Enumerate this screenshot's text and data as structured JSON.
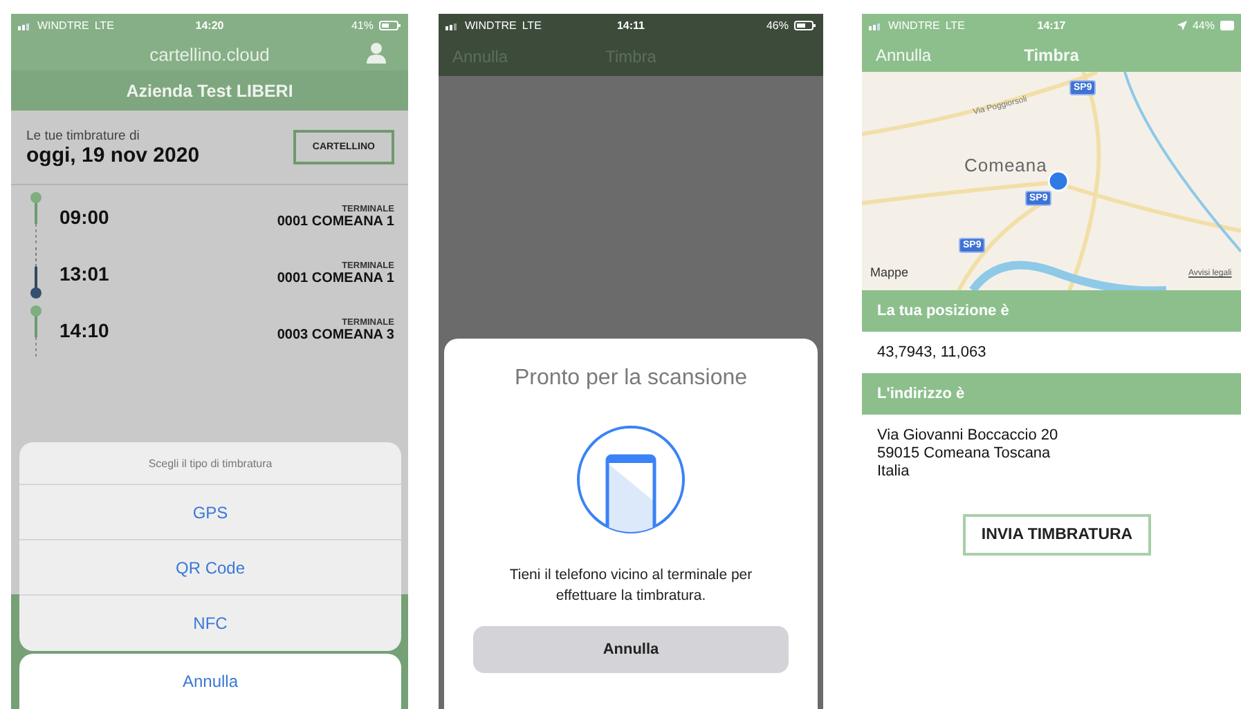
{
  "left_screen": {
    "status_bar": {
      "carrier": "WINDTRE",
      "network": "LTE",
      "time": "14:20",
      "battery": "41%",
      "location_services": false
    },
    "header": {
      "title": "cartellino.cloud",
      "company": "Azienda Test LIBERI"
    },
    "date_section": {
      "label": "Le tue timbrature di",
      "date": "oggi, 19 nov 2020",
      "button": "CARTELLINO"
    },
    "entries": [
      {
        "kind": "in",
        "time": "09:00",
        "terminal_label": "TERMINALE",
        "terminal": "0001 COMEANA 1"
      },
      {
        "kind": "out",
        "time": "13:01",
        "terminal_label": "TERMINALE",
        "terminal": "0001 COMEANA 1"
      },
      {
        "kind": "in",
        "time": "14:10",
        "terminal_label": "TERMINALE",
        "terminal": "0003 COMEANA 3"
      }
    ],
    "action_sheet": {
      "title": "Scegli il tipo di timbratura",
      "options": [
        "GPS",
        "QR Code",
        "NFC"
      ],
      "cancel": "Annulla"
    }
  },
  "middle_screen": {
    "status_bar": {
      "carrier": "WINDTRE",
      "network": "LTE",
      "time": "14:11",
      "battery": "46%",
      "location_services": false
    },
    "nav": {
      "left": "Annulla",
      "title": "Timbra"
    },
    "scan_sheet": {
      "title": "Pronto per la scansione",
      "message": "Tieni il telefono vicino al terminale per effettuare la timbratura.",
      "button": "Annulla"
    }
  },
  "right_screen": {
    "status_bar": {
      "carrier": "WINDTRE",
      "network": "LTE",
      "time": "14:17",
      "battery": "44%",
      "location_services": true
    },
    "nav": {
      "left": "Annulla",
      "title": "Timbra"
    },
    "map": {
      "labels": [
        {
          "kind": "road",
          "text": "Via Poggiorsoli"
        },
        {
          "kind": "shield",
          "text": "SP9"
        },
        {
          "kind": "town",
          "text": "Comeana"
        },
        {
          "kind": "shield",
          "text": "SP9"
        },
        {
          "kind": "shield",
          "text": "SP9"
        },
        {
          "kind": "attribution",
          "text": "Mappe"
        },
        {
          "kind": "legal",
          "text": "Avvisi legali"
        }
      ]
    },
    "position_heading": "La tua posizione è",
    "position": "43,7943, 11,063",
    "address_heading": "L'indirizzo è",
    "address_lines": [
      "Via Giovanni Boccaccio 20",
      "59015 Comeana Toscana",
      "Italia"
    ],
    "send_button": "INVIA TIMBRATURA"
  }
}
